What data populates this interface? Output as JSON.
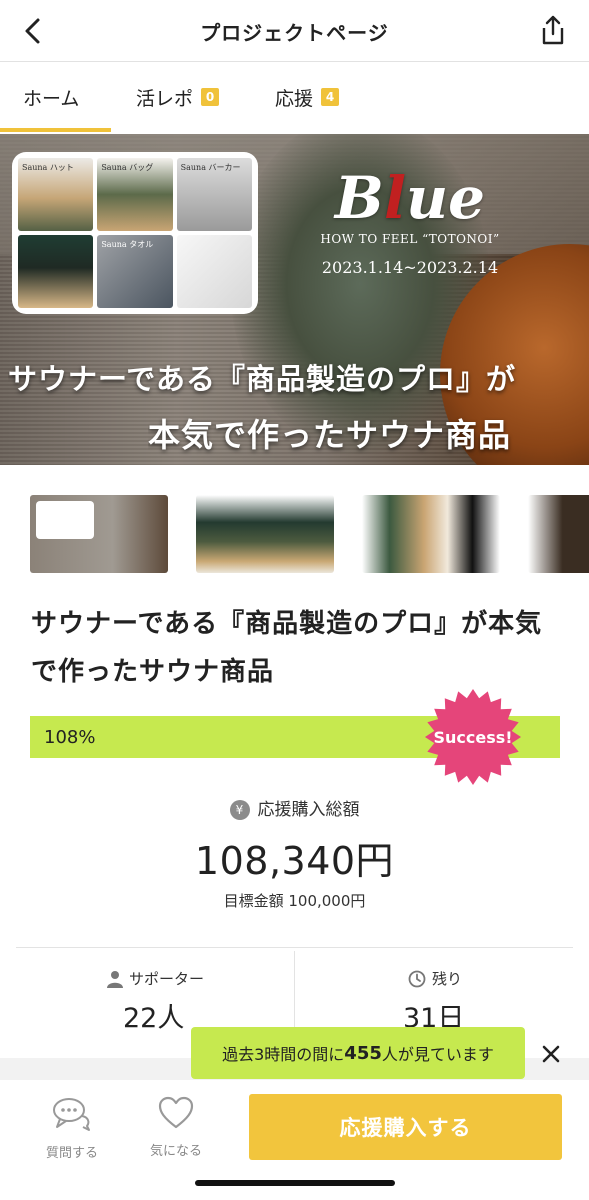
{
  "header": {
    "title": "プロジェクトページ",
    "back_icon": "chevron-left-icon",
    "share_icon": "share-icon"
  },
  "tabs": [
    {
      "label": "ホーム",
      "active": true
    },
    {
      "label": "活レポ",
      "badge": "0"
    },
    {
      "label": "応援",
      "badge": "4"
    }
  ],
  "hero": {
    "brand": "Blue",
    "brand_subtitle": "HOW TO FEEL “TOTONOI”",
    "dates": "2023.1.14~2023.2.14",
    "line1": "サウナーである『商品製造のプロ』が",
    "line2": "本気で作ったサウナ商品",
    "collage_labels": [
      "Sauna ハット",
      "Sauna バッグ",
      "Sauna バーカー",
      "",
      "Sauna タオル",
      ""
    ]
  },
  "project": {
    "title": "サウナーである『商品製造のプロ』が本気で作ったサウナ商品",
    "progress_percent": 108,
    "progress_label": "108%",
    "success_badge": "Success!",
    "amount_label": "応援購入総額",
    "amount": "108,340円",
    "goal": "目標金額 100,000円",
    "supporters_label": "サポーター",
    "supporters_value": "22人",
    "remaining_label": "残り",
    "remaining_value": "31日"
  },
  "toast": {
    "prefix": "過去3時間の間に",
    "count": "455",
    "suffix": "人が見ています"
  },
  "bottom": {
    "ask_label": "質問する",
    "fav_label": "気になる",
    "cta_label": "応援購入する"
  },
  "colors": {
    "accent": "#f2c53d",
    "progress": "#c6e94f",
    "success": "#e5457a"
  }
}
